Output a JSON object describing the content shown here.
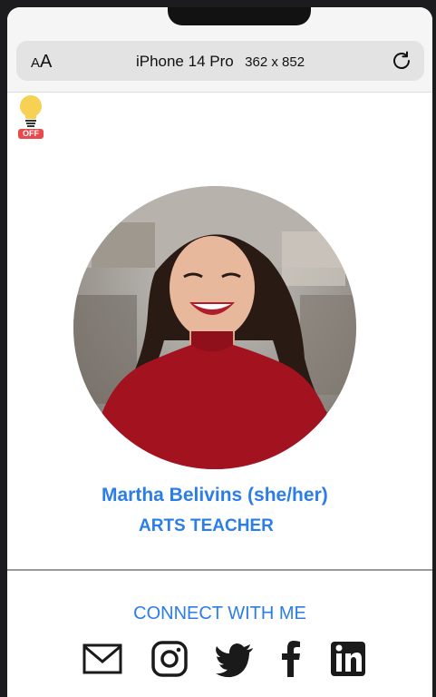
{
  "browser": {
    "text_size_small": "A",
    "text_size_big": "A",
    "device_name": "iPhone 14 Pro",
    "device_size": "362 x 852"
  },
  "theme_toggle": {
    "state_label": "OFF",
    "icon": "lightbulb-icon"
  },
  "profile": {
    "name": "Martha Belivins (she/her)",
    "title": "ARTS TEACHER",
    "photo": "profile-photo"
  },
  "connect": {
    "heading": "CONNECT WITH ME",
    "links": [
      {
        "icon": "email-icon"
      },
      {
        "icon": "instagram-icon"
      },
      {
        "icon": "twitter-icon"
      },
      {
        "icon": "facebook-icon"
      },
      {
        "icon": "linkedin-icon"
      }
    ]
  },
  "colors": {
    "accent": "#2b7de9",
    "badge_off": "#e8494a",
    "bulb": "#f7d154"
  }
}
